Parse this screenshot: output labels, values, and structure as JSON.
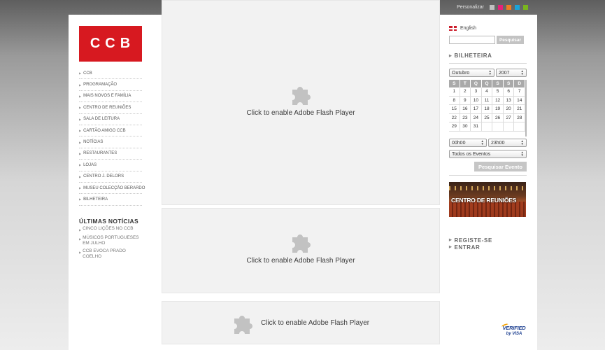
{
  "personalize": {
    "label": "Personalizar",
    "swatches": [
      "#c0c0c0",
      "#e8207a",
      "#ef7d22",
      "#1aa3d9",
      "#7ab51d"
    ]
  },
  "logo": {
    "text": "CCB",
    "color": "#d71920"
  },
  "left_nav": {
    "items": [
      "CCB",
      "PROGRAMAÇÃO",
      "MAIS NOVOS E FAMÍLIA",
      "CENTRO DE REUNIÕES",
      "SALA DE LEITURA",
      "CARTÃO AMIGO CCB",
      "NOTÍCIAS",
      "RESTAURANTES",
      "LOJAS",
      "CENTRO J. DELORS",
      "MUSEU COLECÇÃO BERARDO",
      "BILHETEIRA"
    ]
  },
  "news": {
    "title": "ÚLTIMAS NOTÍCIAS",
    "items": [
      "CINCO LIÇÕES NO CCB",
      "MÚSICOS PORTUGUESES EM JULHO",
      "CCB EVOCA PRADO COELHO"
    ]
  },
  "flash": {
    "message": "Click to enable Adobe Flash Player",
    "icon": "puzzle-piece-icon"
  },
  "right": {
    "language": "English",
    "search_placeholder": "",
    "search_button": "Pesquisar",
    "bilheteira": "BILHETEIRA",
    "month_select": "Outubro",
    "year_select": "2007",
    "weekdays": [
      "S",
      "T",
      "Q",
      "Q",
      "S",
      "S",
      "D"
    ],
    "days": [
      "1",
      "2",
      "3",
      "4",
      "5",
      "6",
      "7",
      "8",
      "9",
      "10",
      "11",
      "12",
      "13",
      "14",
      "15",
      "16",
      "17",
      "18",
      "19",
      "20",
      "21",
      "22",
      "23",
      "24",
      "25",
      "26",
      "27",
      "28",
      "29",
      "30",
      "31",
      "",
      "",
      "",
      ""
    ],
    "time_from": "00h00",
    "time_to": "23h00",
    "event_type": "Todos os Eventos",
    "event_search_button": "Pesquisar Evento",
    "banner_title": "CENTRO DE REUNIÕES",
    "register": "REGISTE-SE",
    "login": "ENTRAR",
    "visa_line1": "VERIFIED",
    "visa_line2": "by VISA"
  }
}
